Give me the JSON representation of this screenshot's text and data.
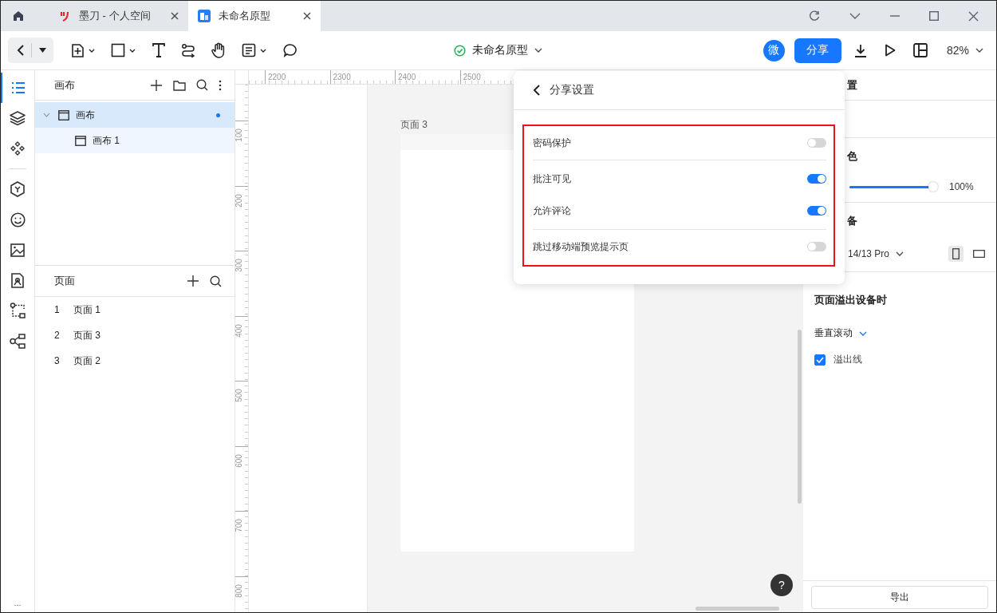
{
  "tabs": [
    {
      "kind": "home",
      "selected": false
    },
    {
      "kind": "page",
      "title": "墨刀 - 个人空间",
      "selected": false
    },
    {
      "kind": "page",
      "title": "未命名原型",
      "selected": true
    }
  ],
  "toolbar": {
    "doc_title": "未命名原型",
    "avatar": "微",
    "share_button": "分享",
    "zoom": "82%"
  },
  "rail": [
    {
      "selected": true
    },
    {
      "selected": false
    },
    {
      "selected": false
    },
    {
      "selected": false
    },
    {
      "selected": false
    },
    {
      "selected": false
    },
    {
      "selected": false
    },
    {
      "selected": false
    },
    {
      "selected": false
    }
  ],
  "rail_more": "...",
  "layers": {
    "title": "画布",
    "tree": [
      {
        "label": "画布",
        "selected": true,
        "expanded": true,
        "children": [
          {
            "label": "画布 1"
          }
        ]
      }
    ]
  },
  "pages": {
    "title": "页面",
    "items": [
      {
        "number": "1",
        "name": "页面 1"
      },
      {
        "number": "2",
        "name": "页面 3"
      },
      {
        "number": "3",
        "name": "页面 2"
      }
    ]
  },
  "rulers": {
    "horizontal": [
      "2200",
      "2300",
      "2400",
      "2500"
    ],
    "vertical": [
      "100",
      "200",
      "300",
      "400",
      "500",
      "600",
      "700",
      "800"
    ]
  },
  "canvas": {
    "frame_label": "页面 3",
    "help_button": "?"
  },
  "share_popup": {
    "title": "分享设置",
    "groups": [
      [
        {
          "label": "密码保护",
          "on": false
        }
      ],
      [
        {
          "label": "批注可见",
          "on": true
        },
        {
          "label": "允许评论",
          "on": true
        }
      ],
      [
        {
          "label": "跳过移动端预览提示页",
          "on": false
        }
      ]
    ]
  },
  "right_panel": {
    "heading": "置",
    "color_label": "色",
    "opacity": {
      "level": 1,
      "reading": "100%"
    },
    "device_label": "备",
    "device": "14/13 Pro",
    "overflow_heading": "页面溢出设备时",
    "scroll_mode": "垂直滚动",
    "overflow_line": {
      "label": "溢出线",
      "checked": true
    },
    "export_button": "导出"
  }
}
